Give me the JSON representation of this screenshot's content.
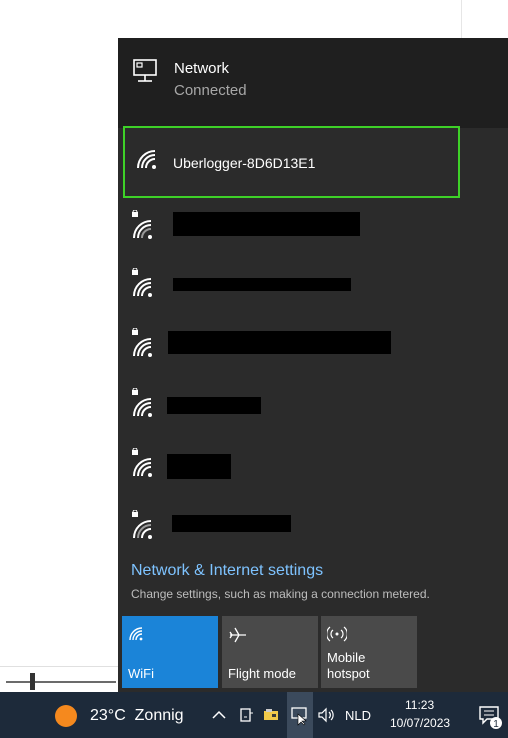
{
  "network": {
    "title": "Network",
    "status": "Connected"
  },
  "wifi_list": [
    {
      "name": "Uberlogger-8D6D13E1",
      "secured": false,
      "selected": true
    },
    {
      "name": "",
      "secured": true
    },
    {
      "name": "",
      "secured": true
    },
    {
      "name": "",
      "secured": true
    },
    {
      "name": "",
      "secured": true
    },
    {
      "name": "",
      "secured": true
    },
    {
      "name": "",
      "secured": true
    }
  ],
  "settings": {
    "link": "Network & Internet settings",
    "subtitle": "Change settings, such as making a connection metered."
  },
  "quick_actions": [
    {
      "label": "WiFi",
      "active": true,
      "icon": "wifi-icon"
    },
    {
      "label": "Flight mode",
      "active": false,
      "icon": "airplane-icon"
    },
    {
      "label": "Mobile\nhotspot",
      "active": false,
      "icon": "hotspot-icon"
    }
  ],
  "taskbar": {
    "weather": "23°C  Zonnig",
    "language": "NLD",
    "time": "11:23",
    "date": "10/07/2023",
    "notification_count": "1"
  },
  "colors": {
    "accent": "#1b84d8",
    "highlight_border": "#3ed128",
    "link": "#7ec3ff"
  }
}
